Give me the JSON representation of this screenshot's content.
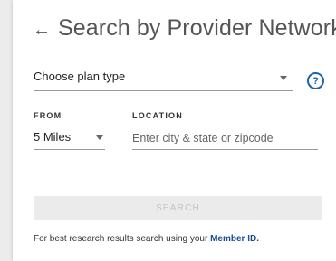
{
  "header": {
    "back_icon": "arrow-left-icon",
    "back_glyph": "←",
    "title": "Search by Provider Network"
  },
  "plan": {
    "placeholder": "Choose plan type",
    "caret_icon": "caret-down-icon",
    "help_icon": "question-circle-icon",
    "help_glyph": "?"
  },
  "from": {
    "label": "FROM",
    "value": "5 Miles"
  },
  "location": {
    "label": "LOCATION",
    "placeholder": "Enter city & state or zipcode"
  },
  "search": {
    "label": "SEARCH",
    "disabled": true
  },
  "hint": {
    "text": "For best research results search using your ",
    "link": "Member ID."
  },
  "colors": {
    "accent": "#1a64b0",
    "link": "#1a4e8c",
    "disabled_button": "#ebebeb"
  }
}
